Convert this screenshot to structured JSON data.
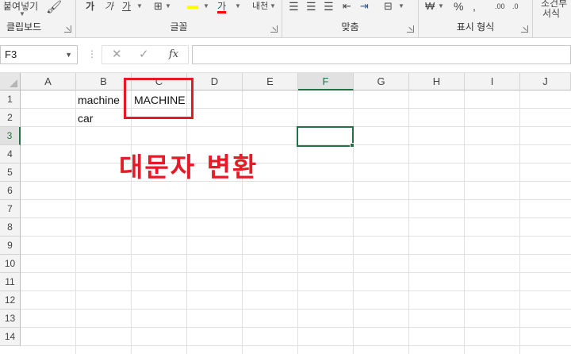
{
  "ribbon": {
    "clipboard": {
      "paste_label": "붙여넣기",
      "group_label": "클립보드"
    },
    "font": {
      "bold": "가",
      "italic": "가",
      "underline": "가",
      "font_color_letter": "가",
      "fill_color": "#ffff00",
      "font_color": "#ff0000",
      "group_label": "글꼴"
    },
    "alignment": {
      "group_label": "맞춤"
    },
    "number": {
      "percent": "%",
      "group_label": "표시 형식"
    },
    "styles": {
      "conditional_label": "조건부",
      "format_label": "서식"
    }
  },
  "formula_bar": {
    "name_box": "F3",
    "formula_value": ""
  },
  "columns": [
    "A",
    "B",
    "C",
    "D",
    "E",
    "F",
    "G",
    "H",
    "I",
    "J"
  ],
  "rows": [
    "1",
    "2",
    "3",
    "4",
    "5",
    "6",
    "7",
    "8",
    "9",
    "10",
    "11",
    "12",
    "13",
    "14"
  ],
  "selected_cell": "F3",
  "cells": {
    "B1": "machine",
    "C1": "MACHINE",
    "B2": "car"
  },
  "annotation": {
    "text": "대문자 변환",
    "color": "#e51a24"
  }
}
